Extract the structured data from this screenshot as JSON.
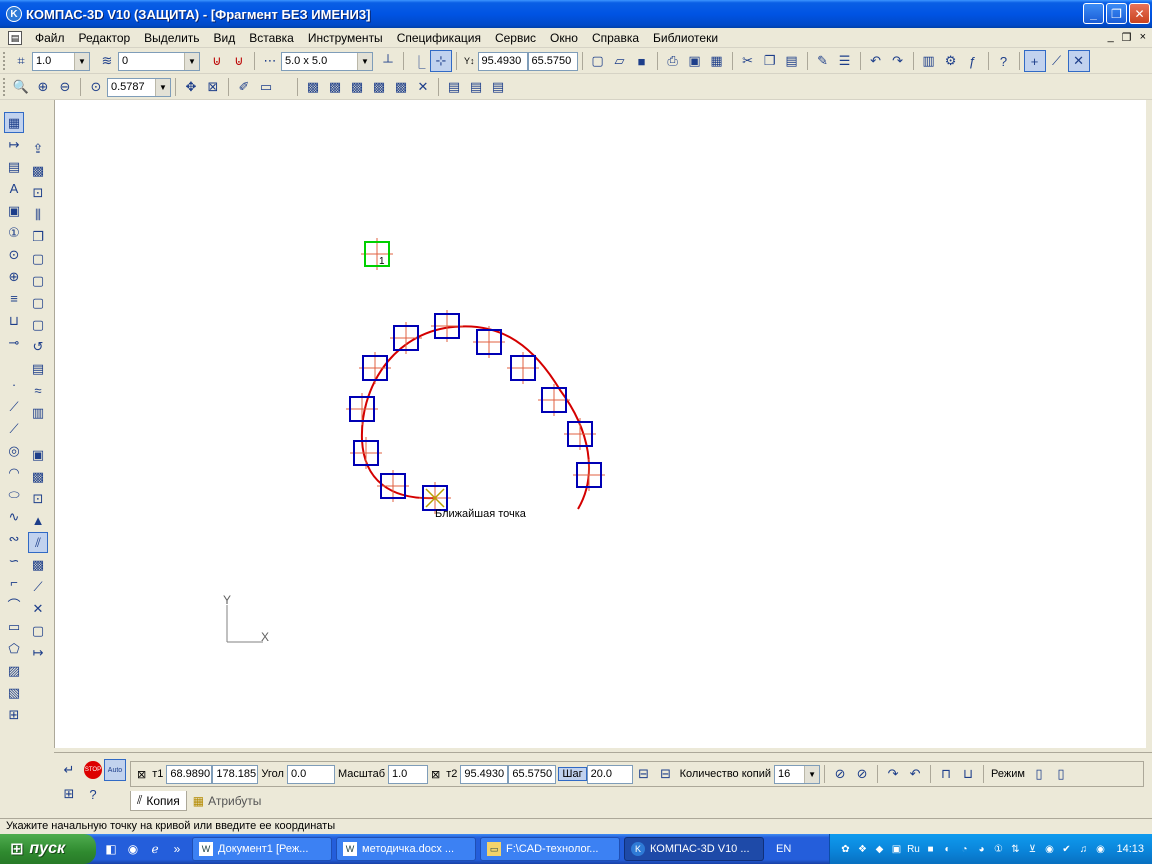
{
  "window": {
    "title": "КОМПАС-3D V10 (ЗАЩИТА) - [Фрагмент БЕЗ ИМЕНИ3]",
    "app_icon": "K",
    "minimize": "_",
    "restore": "❐",
    "close": "✕"
  },
  "menu": {
    "items": [
      "Файл",
      "Редактор",
      "Выделить",
      "Вид",
      "Вставка",
      "Инструменты",
      "Спецификация",
      "Сервис",
      "Окно",
      "Справка",
      "Библиотеки"
    ],
    "mdi_min": "_",
    "mdi_restore": "❐",
    "mdi_close": "×"
  },
  "toolbar1": {
    "line_scale": "1.0",
    "layer": "0",
    "grid": "5.0 x 5.0",
    "x": "95.4930",
    "y": "65.5750"
  },
  "toolbar2": {
    "zoom": "0.5787"
  },
  "canvas": {
    "curve_color": "#D40000",
    "box_color": "#0000B4",
    "start_box_color": "#00D000",
    "start_label": "1",
    "tooltip": "Ближайшая точка",
    "axis_x": "X",
    "axis_y": "Y"
  },
  "properties": {
    "t1_label": "т1",
    "t1_x": "68.9890",
    "t1_y": "178.185",
    "angle_label": "Угол",
    "angle": "0.0",
    "scale_label": "Масштаб",
    "scale": "1.0",
    "t2_label": "т2",
    "t2_x": "95.4930",
    "t2_y": "65.5750",
    "step_label": "Шаг",
    "step": "20.0",
    "count_label": "Количество копий",
    "count": "16",
    "mode_label": "Режим",
    "tab_copy": "Копия",
    "tab_attributes": "Атрибуты",
    "stop_label": "STOP",
    "auto_label": "Auto"
  },
  "status": {
    "text": "Укажите начальную точку на кривой или введите ее координаты"
  },
  "taskbar": {
    "start": "пуск",
    "tasks": [
      "Документ1 [Реж...",
      "методичка.docx ...",
      "F:\\CAD-технолог...",
      "КОМПАС-3D V10 ..."
    ],
    "lang": "EN",
    "clock": "14:13"
  }
}
